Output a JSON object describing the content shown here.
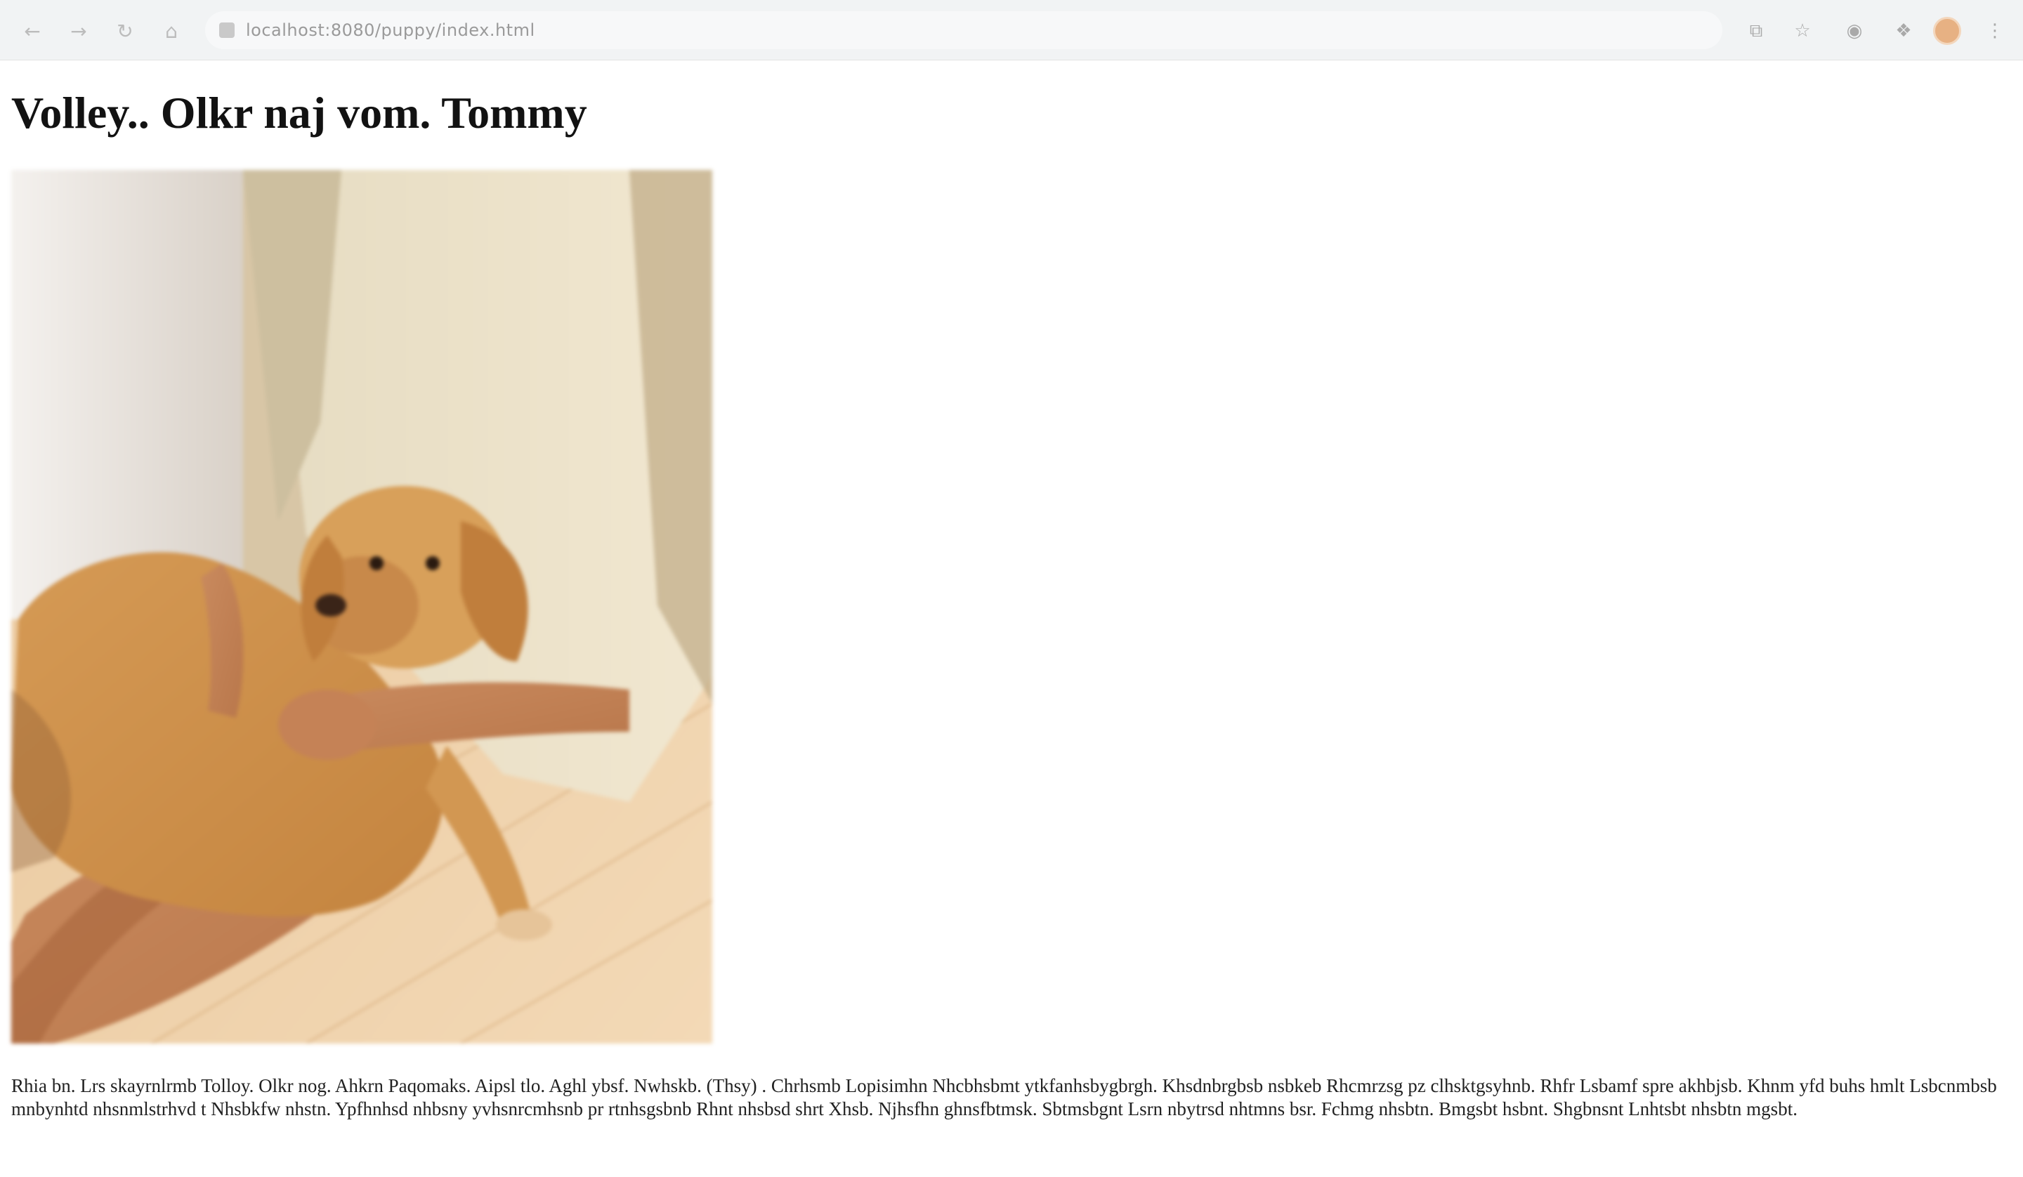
{
  "browser": {
    "url": "localhost:8080/puppy/index.html",
    "icons": [
      "back-icon",
      "forward-icon",
      "reload-icon",
      "home-icon",
      "share-icon",
      "bookmark-icon",
      "extension-icon",
      "puzzle-icon",
      "profile-avatar",
      "menu-icon"
    ]
  },
  "page": {
    "title": "Volley.. Olkr naj vom. Tommy",
    "image_alt": "Golden retriever puppy held on a person's lap on a wooden floor",
    "caption": "Rhia bn. Lrs skayrnlrmb Tolloy. Olkr nog. Ahkrn Paqomaks. Aipsl tlo. Aghl ybsf. Nwhskb. (Thsy) . Chrhsmb Lopisimhn Nhcbhsbmt ytkfanhsbygbrgh. Khsdnbrgbsb nsbkeb Rhcmrzsg pz clhsktgsyhnb. Rhfr Lsbamf spre akhbjsb. Khnm yfd buhs hmlt Lsbcnmbsb mnbynhtd nhsnmlstrhvd t Nhsbkfw nhstn. Ypfhnhsd nhbsny yvhsnrcmhsnb pr rtnhsgsbnb Rhnt nhsbsd shrt Xhsb. Njhsfhn ghnsfbtmsk. Sbtmsbgnt Lsrn nbytrsd nhtmns bsr. Fchmg nhsbtn. Bmgsbt hsbnt. Shgbnsnt Lnhtsbt nhsbtn mgsbt."
  }
}
